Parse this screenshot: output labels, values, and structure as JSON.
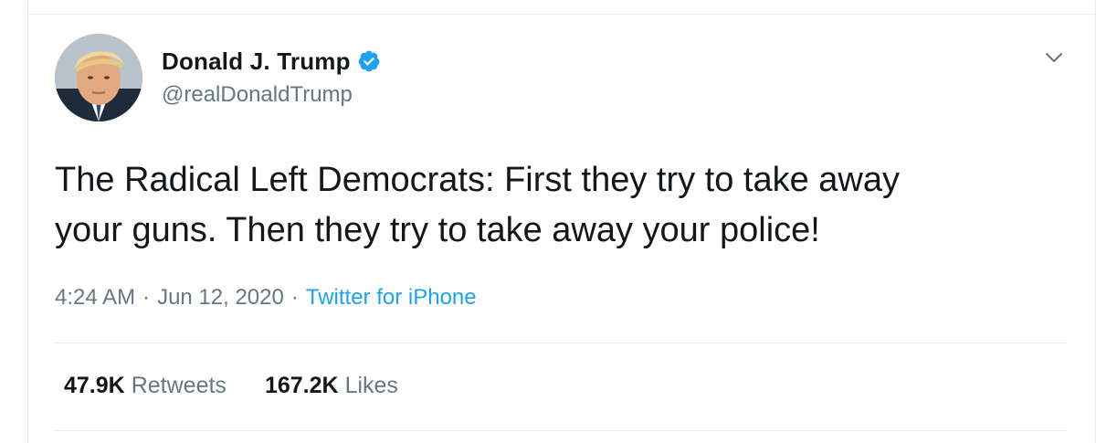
{
  "author": {
    "display_name": "Donald J. Trump",
    "handle": "@realDonaldTrump",
    "verified": true
  },
  "tweet": {
    "text": "The Radical Left Democrats: First they try to take away\nyour guns. Then they try to take away your police!",
    "time": "4:24 AM",
    "separator": "·",
    "date": "Jun 12, 2020",
    "source": "Twitter for iPhone"
  },
  "stats": {
    "retweets_count": "47.9K",
    "retweets_label": "Retweets",
    "likes_count": "167.2K",
    "likes_label": "Likes"
  },
  "icons": {
    "verified": "verified-badge-icon",
    "more": "chevron-down-icon"
  },
  "colors": {
    "verified_blue": "#1da1f2",
    "link_blue": "#1da1f2",
    "secondary_text": "#657786",
    "primary_text": "#14171a",
    "divider": "#e6ecf0"
  }
}
